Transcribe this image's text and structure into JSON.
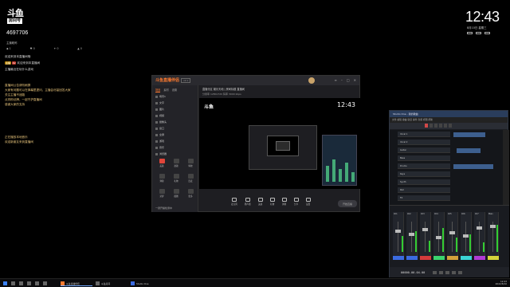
{
  "overlay": {
    "logo_top": "斗鱼",
    "logo_sub": "房间号",
    "room_number": "4697706",
    "host_label": "主播昵称",
    "stats": [
      "◆ 1",
      "♥ 0",
      "✦ 0",
      "▲ 0"
    ],
    "chat": [
      {
        "text": "欢迎来到本直播间哦"
      },
      {
        "badge": "主播",
        "text": "欢迎来到本直播间"
      },
      {
        "text": "主播最近在玩什么游戏"
      }
    ],
    "notice": [
      "直播间公告请勿刷屏",
      "大家有问题可以在弹幕里提问，主播会尽量回答大家",
      "关注主播不迷路",
      "点亮粉丝牌，一起守护直播间",
      "感谢大家的支持"
    ],
    "notice2": [
      "正在播放本地音乐",
      "欢迎新朋友来到直播间"
    ]
  },
  "clock": {
    "time": "12:43",
    "date": "8月10日 星期三"
  },
  "stream_tool": {
    "app_name": "斗鱼直播伴侣",
    "version": "v2.x",
    "tabs": [
      "场景",
      "素材",
      "设置"
    ],
    "scenes": [
      "场景1",
      "文字",
      "图片",
      "视频",
      "摄像头",
      "窗口",
      "全屏",
      "游戏",
      "音乐",
      "浏览器",
      "直播流",
      "本地录制"
    ],
    "tools": [
      "美颜",
      "滤镜",
      "特效",
      "弹幕",
      "礼物",
      "连麦",
      "录屏",
      "截图",
      "更多"
    ],
    "bottom_note": "一键开播检测中",
    "info_line": "直播分区 娱乐天地  |  房间标题  直播间",
    "info_line2": "分辨率 1280x720  码率 3000 kbps",
    "preview_logo": "斗鱼",
    "preview_clock": "12:43",
    "controls": [
      "麦克风",
      "扬声器",
      "美颜",
      "礼物",
      "弹幕",
      "分享",
      "设置"
    ],
    "go_live": "开始直播"
  },
  "daw": {
    "title": "Studio One - 我的歌曲",
    "menu": "文件  编辑  歌曲  轨道  事件  音频  视图  帮助",
    "tracks": [
      "Vocal 1",
      "Vocal 2",
      "Guitar",
      "Bass",
      "Drums",
      "Keys",
      "Synth",
      "Pad",
      "FX"
    ],
    "channels": [
      "Ch1",
      "Ch2",
      "Ch3",
      "Ch4",
      "Ch5",
      "Ch6",
      "Ch7",
      "Main"
    ],
    "channel_colors": [
      "#3b6be0",
      "#3b6be0",
      "#d43b3b",
      "#3bd46e",
      "#d4a13b",
      "#3bd4d4",
      "#b03bd4",
      "#d4d43b"
    ],
    "timecode": "00000.00.04.00"
  },
  "taskbar": {
    "items": [
      "斗鱼直播伴侣",
      "斗鱼房间",
      "Studio One"
    ],
    "time": "12:43",
    "date": "2022/8/10"
  }
}
